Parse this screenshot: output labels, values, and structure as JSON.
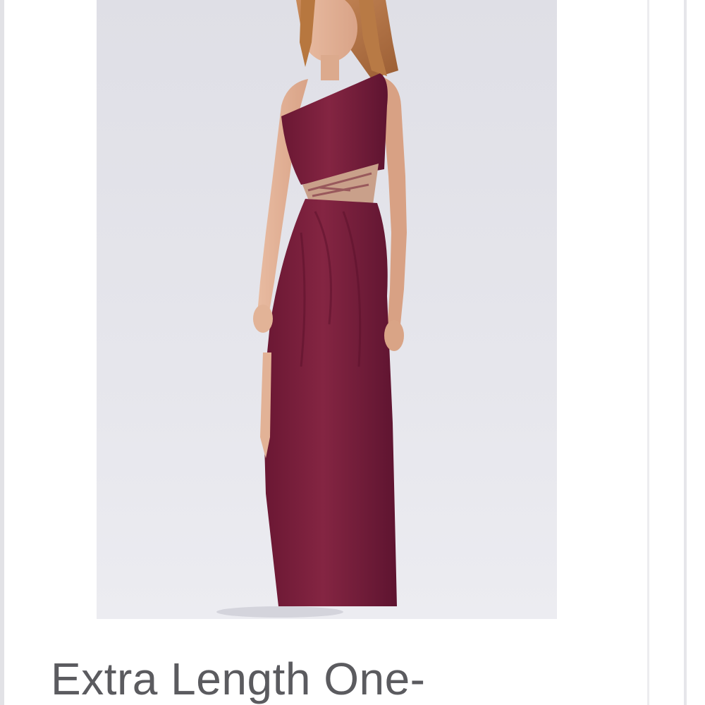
{
  "product": {
    "title": "Extra Length One-",
    "image_subject": "model wearing a long one-shoulder wine-colored gown with lace waist inset",
    "colors": {
      "dress": "#7a1f3d",
      "background": "#e4e4ea",
      "title_text": "#5b5b5f"
    }
  }
}
